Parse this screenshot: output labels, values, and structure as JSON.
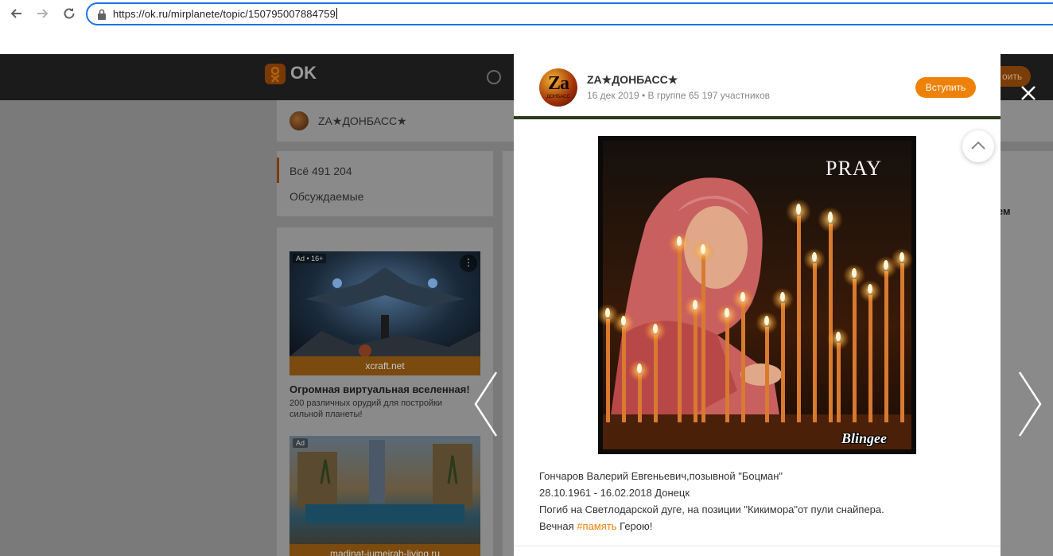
{
  "browser": {
    "url": "https://ok.ru/mirplanete/topic/150795007884759"
  },
  "site": {
    "logo_text": "OK",
    "topbar_button": "оить",
    "group_name": "ZA★ДОНБАСС★",
    "filters": [
      {
        "label": "Всё 491 204"
      },
      {
        "label": "Обсуждаемые"
      }
    ],
    "feed_partial_text": "нем",
    "ads": [
      {
        "label": "Ad • 16+",
        "source": "xcraft.net",
        "title": "Огромная виртуальная вселенная!",
        "description": "200 различных орудий для постройки сильной планеты!"
      },
      {
        "label": "Ad",
        "source": "madinat-jumeirah-living.ru"
      }
    ]
  },
  "modal": {
    "group_name": "ZA★ДОНБАСС★",
    "avatar_text": "Za",
    "avatar_subtext": "ДОНБАСС",
    "meta": "16 дек 2019 • В группе 65 197 участников",
    "join_label": "Вступить",
    "image_caption": "PRAY",
    "image_watermark": "Blingee",
    "post_lines": [
      "Гончаров Валерий Евгеньевич,позывной \"Боцман\"",
      "28.10.1961 - 16.02.2018 Донецк",
      "Погиб на Светлодарской дуге, на позиции \"Кикимора\"от пули снайпера."
    ],
    "last_line": {
      "before": "Вечная ",
      "hashtag": "#память",
      "after": " Герою!"
    }
  },
  "icons": {
    "back": "arrow-left-icon",
    "forward": "arrow-right-icon",
    "reload": "reload-icon",
    "lock": "lock-icon",
    "close": "close-icon",
    "prev": "chevron-left-icon",
    "next": "chevron-right-icon",
    "scroll_up": "chevron-up-icon",
    "more": "dots-vertical-icon"
  },
  "colors": {
    "accent": "#ee8208",
    "browser_focus": "#1a73e8",
    "overlay": "#7a7a7a"
  }
}
